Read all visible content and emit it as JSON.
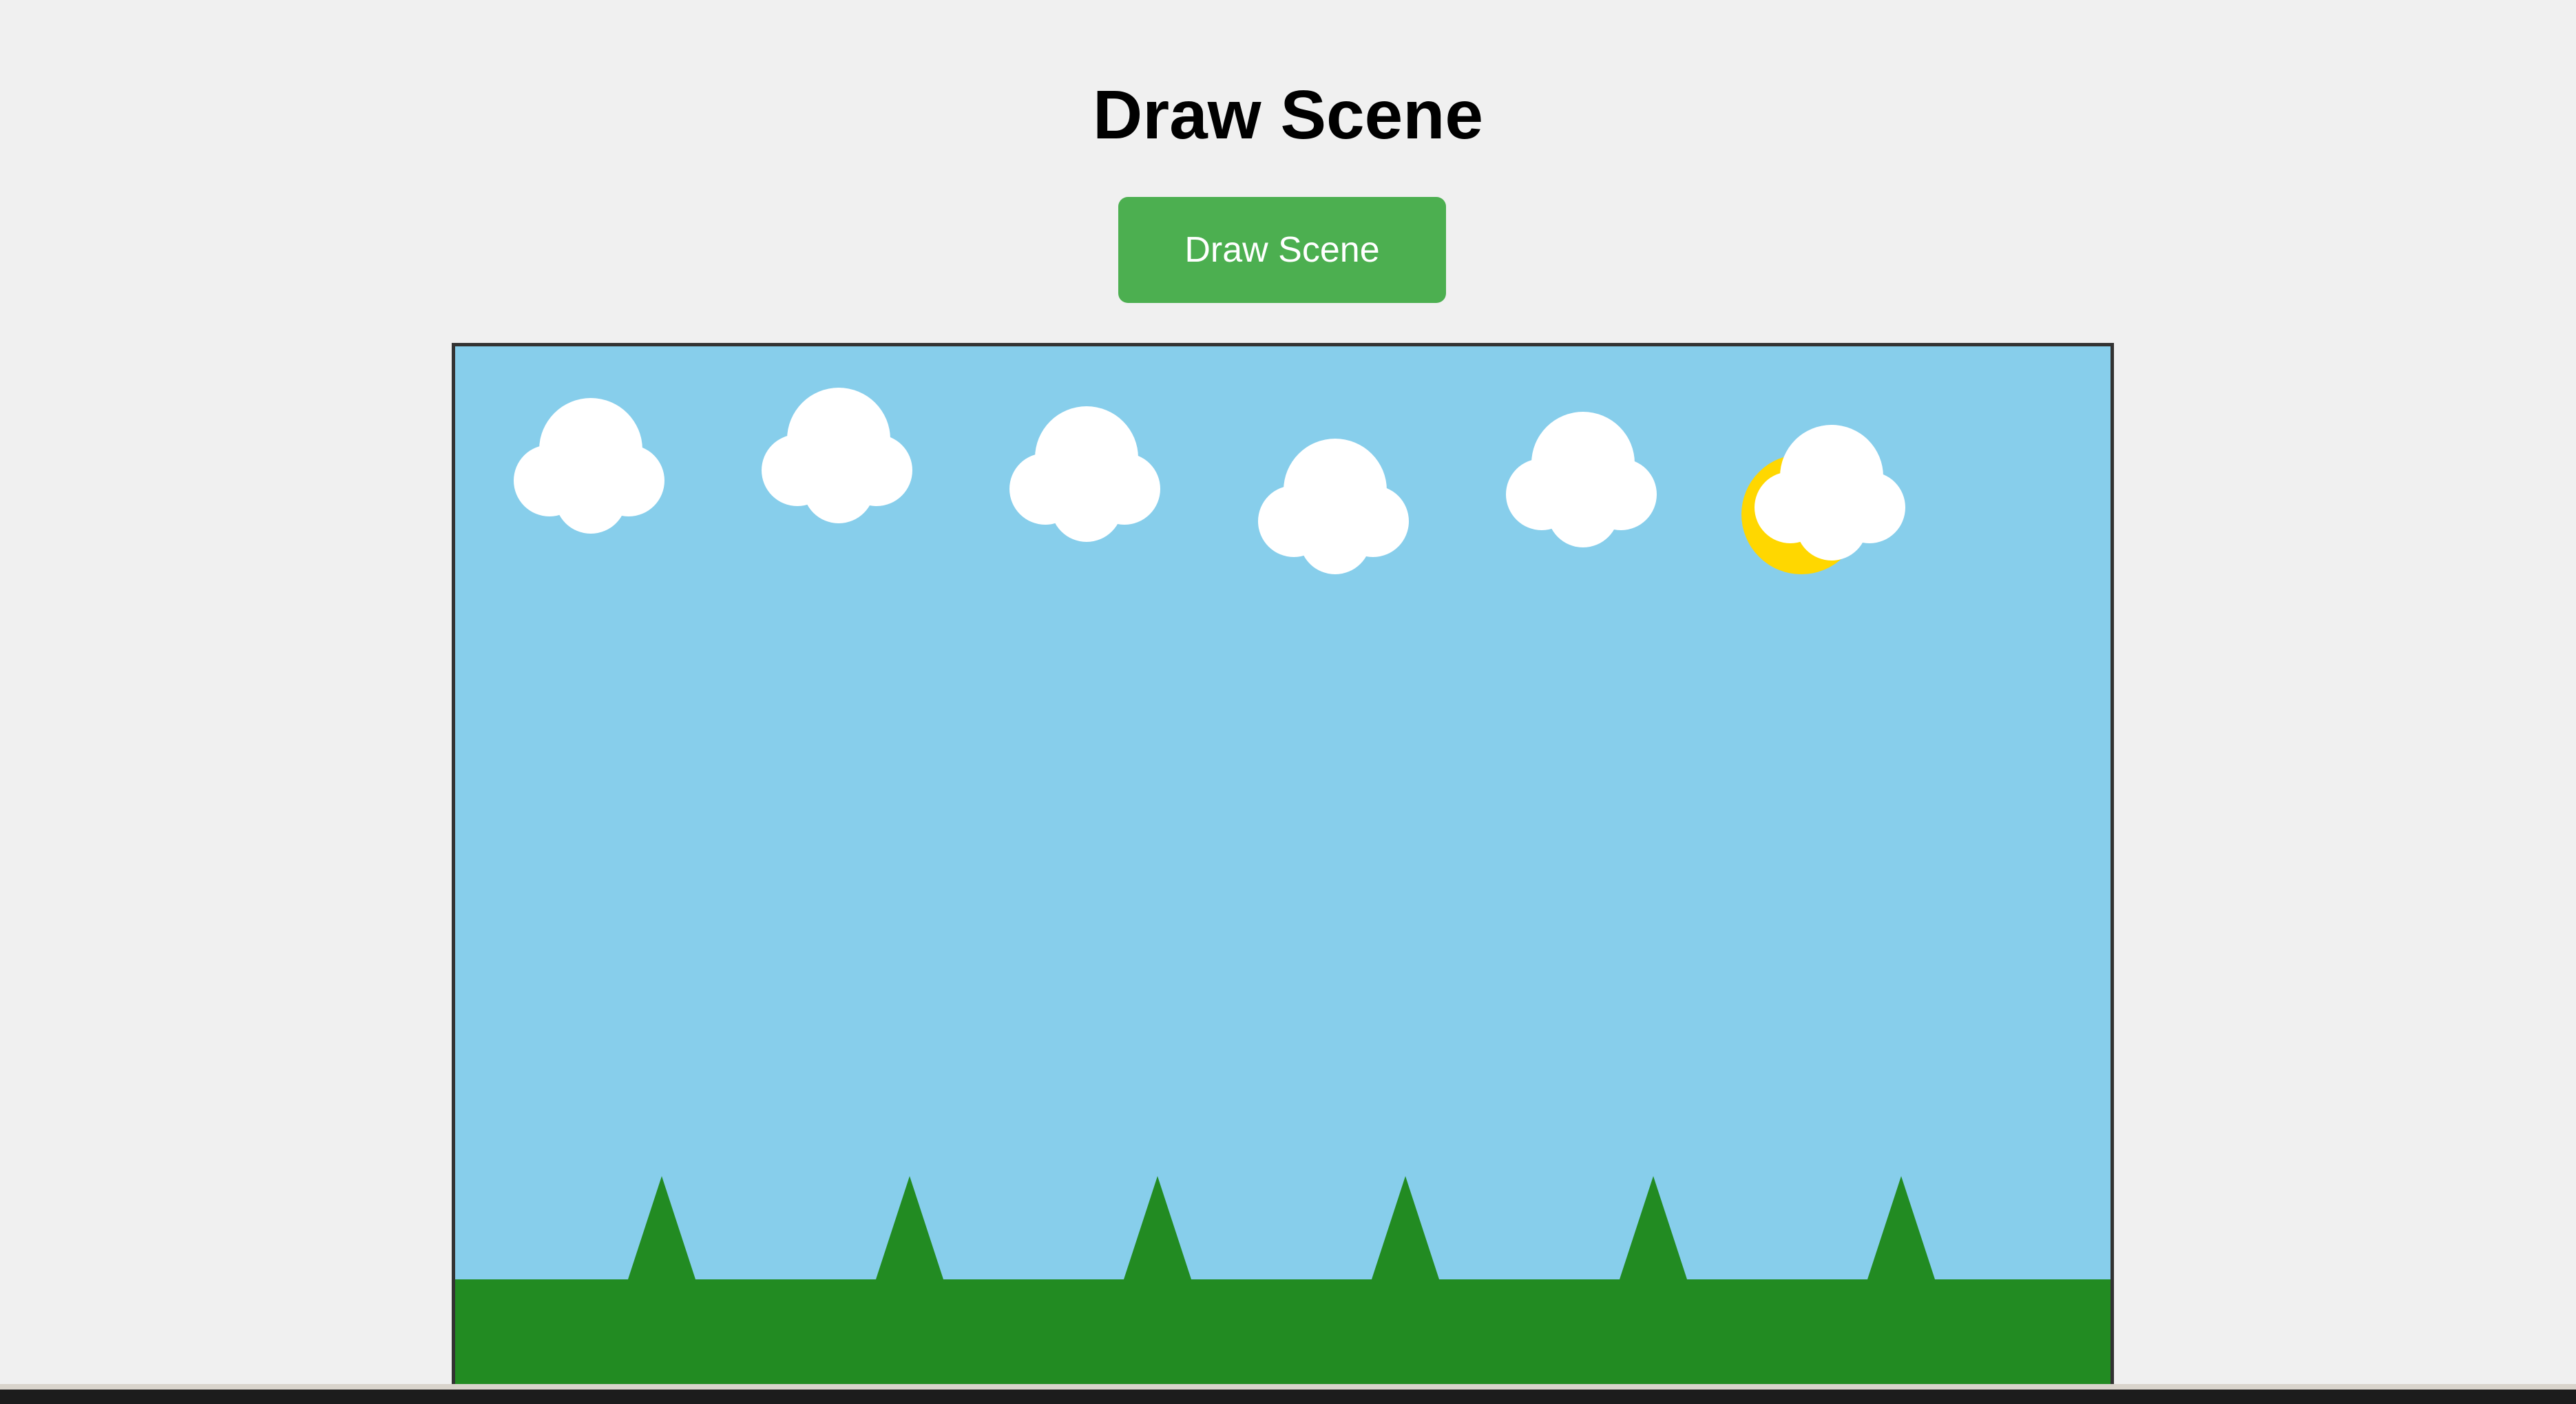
{
  "page": {
    "title": "Draw Scene"
  },
  "controls": {
    "draw_button_label": "Draw Scene"
  },
  "scene": {
    "colors": {
      "sky": "#87ceeb",
      "ground": "#228b22",
      "cloud": "#ffffff",
      "sun": "#ffd700",
      "frame_border": "#333333",
      "button": "#4caf50"
    },
    "cloud_count": 6,
    "tree_count": 6,
    "sun_count": 1
  }
}
